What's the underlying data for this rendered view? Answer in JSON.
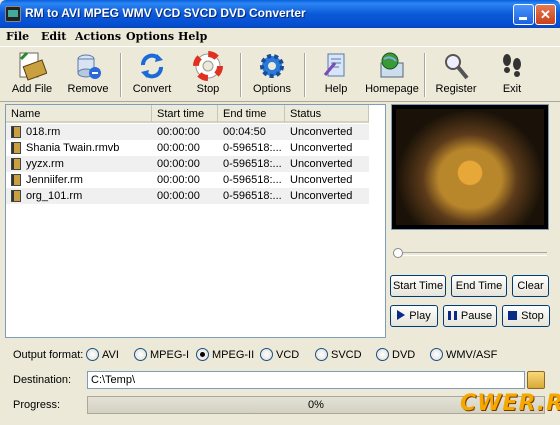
{
  "window": {
    "title": "RM to AVI MPEG WMV VCD SVCD DVD Converter"
  },
  "menu": [
    "File",
    "Edit",
    "Actions",
    "Options",
    "Help"
  ],
  "toolbar": {
    "add_file": "Add File",
    "remove": "Remove",
    "convert": "Convert",
    "stop": "Stop",
    "options": "Options",
    "help": "Help",
    "homepage": "Homepage",
    "register": "Register",
    "exit": "Exit"
  },
  "file_list": {
    "columns": [
      "Name",
      "Start time",
      "End time",
      "Status"
    ],
    "rows": [
      {
        "name": "018.rm",
        "start": "00:00:00",
        "end": "00:04:50",
        "status": "Unconverted"
      },
      {
        "name": "Shania Twain.rmvb",
        "start": "00:00:00",
        "end": "0-596518:...",
        "status": "Unconverted"
      },
      {
        "name": "yyzx.rm",
        "start": "00:00:00",
        "end": "0-596518:...",
        "status": "Unconverted"
      },
      {
        "name": "Jenniifer.rm",
        "start": "00:00:00",
        "end": "0-596518:...",
        "status": "Unconverted"
      },
      {
        "name": "org_101.rm",
        "start": "00:00:00",
        "end": "0-596518:...",
        "status": "Unconverted"
      }
    ]
  },
  "player": {
    "start_time": "Start Time",
    "end_time": "End Time",
    "clear": "Clear",
    "play": "Play",
    "pause": "Pause",
    "stop": "Stop",
    "seek_position": 0
  },
  "output": {
    "label": "Output format:",
    "formats": [
      "AVI",
      "MPEG-I",
      "MPEG-II",
      "VCD",
      "SVCD",
      "DVD",
      "WMV/ASF"
    ],
    "selected": "MPEG-II"
  },
  "destination": {
    "label": "Destination:",
    "value": "C:\\Temp\\"
  },
  "progress": {
    "label": "Progress:",
    "text": "0%",
    "value": 0
  },
  "watermark": "CWER.RU"
}
